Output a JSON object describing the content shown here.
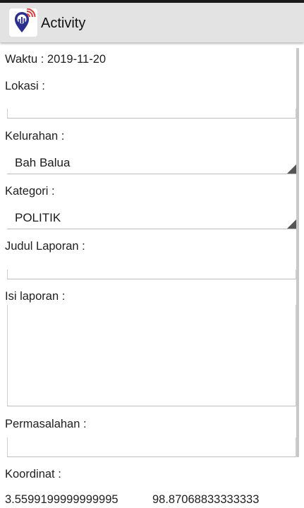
{
  "app": {
    "title": "Activity",
    "icon": "location-pin-signal-icon",
    "accent_color": "#2b2f8f",
    "signal_color": "#e53935"
  },
  "form": {
    "waktu": "Waktu : 2019-11-20",
    "lokasi_label": "Lokasi :",
    "lokasi_value": "",
    "kelurahan_label": "Kelurahan :",
    "kelurahan_value": "Bah Balua",
    "kategori_label": "Kategori :",
    "kategori_value": "POLITIK",
    "judul_label": "Judul Laporan :",
    "judul_value": "",
    "isi_label": "Isi laporan :",
    "isi_value": "",
    "permasalahan_label": "Permasalahan :",
    "permasalahan_value": "",
    "koordinat_label": "Koordinat :",
    "latitude": "3.5599199999999995",
    "longitude": "98.87068833333333"
  }
}
